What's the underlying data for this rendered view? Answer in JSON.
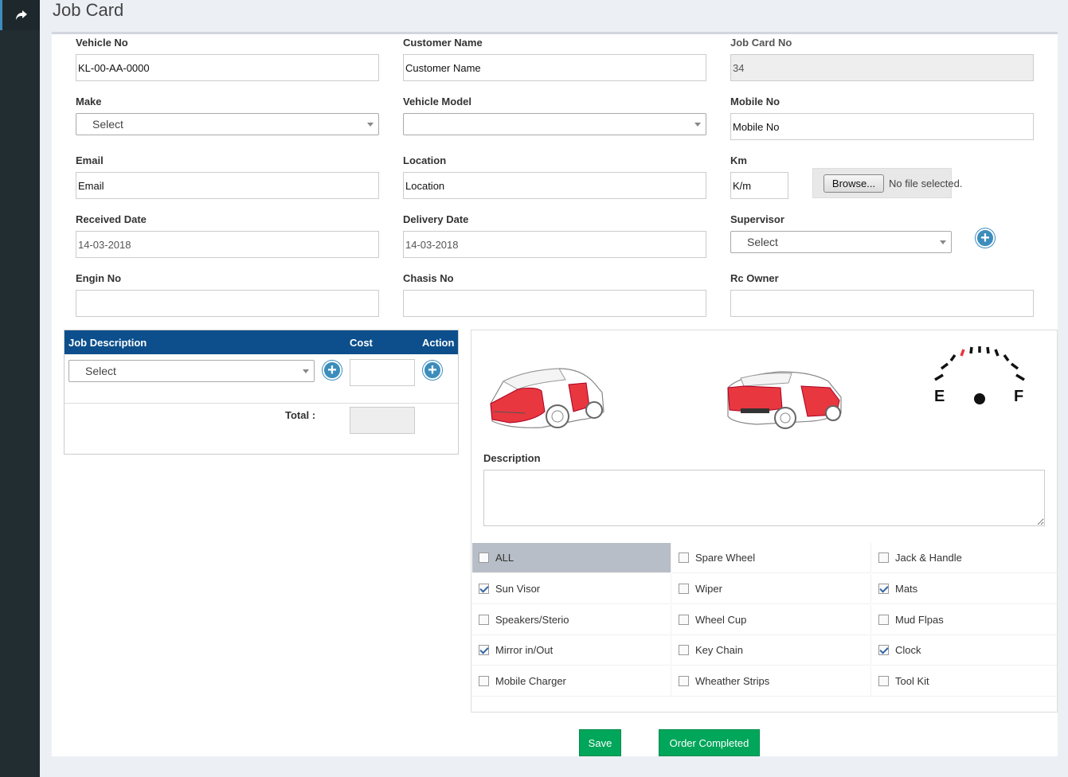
{
  "page": {
    "title": "Job Card"
  },
  "form": {
    "vehicle_no": {
      "label": "Vehicle No",
      "value": "KL-00-AA-0000"
    },
    "customer_name": {
      "label": "Customer Name",
      "value": "Customer Name"
    },
    "job_card_no": {
      "label": "Job Card No",
      "value": "34"
    },
    "make": {
      "label": "Make",
      "value": "Select"
    },
    "vehicle_model": {
      "label": "Vehicle Model",
      "value": ""
    },
    "mobile_no": {
      "label": "Mobile No",
      "value": "Mobile No"
    },
    "email": {
      "label": "Email",
      "value": "Email"
    },
    "location": {
      "label": "Location",
      "value": "Location"
    },
    "km": {
      "label": "Km",
      "value": "K/m"
    },
    "file": {
      "button": "Browse...",
      "status": "No file selected."
    },
    "received_date": {
      "label": "Received Date",
      "value": "14-03-2018"
    },
    "delivery_date": {
      "label": "Delivery Date",
      "value": "14-03-2018"
    },
    "supervisor": {
      "label": "Supervisor",
      "value": "Select"
    },
    "engin_no": {
      "label": "Engin No",
      "value": ""
    },
    "chasis_no": {
      "label": "Chasis No",
      "value": ""
    },
    "rc_owner": {
      "label": "Rc Owner",
      "value": ""
    }
  },
  "job_table": {
    "headers": {
      "description": "Job Description",
      "cost": "Cost",
      "action": "Action"
    },
    "select_value": "Select",
    "total_label": "Total :"
  },
  "inspection": {
    "fuel_empty": "E",
    "fuel_full": "F",
    "description_label": "Description",
    "checklist": [
      {
        "label": "ALL",
        "checked": false
      },
      {
        "label": "Spare Wheel",
        "checked": false
      },
      {
        "label": "Jack & Handle",
        "checked": false
      },
      {
        "label": "Sun Visor",
        "checked": true
      },
      {
        "label": "Wiper",
        "checked": false
      },
      {
        "label": "Mats",
        "checked": true
      },
      {
        "label": "Speakers/Sterio",
        "checked": false
      },
      {
        "label": "Wheel Cup",
        "checked": false
      },
      {
        "label": "Mud Flpas",
        "checked": false
      },
      {
        "label": "Mirror in/Out",
        "checked": true
      },
      {
        "label": "Key Chain",
        "checked": false
      },
      {
        "label": "Clock",
        "checked": true
      },
      {
        "label": "Mobile Charger",
        "checked": false
      },
      {
        "label": "Wheather Strips",
        "checked": false
      },
      {
        "label": "Tool Kit",
        "checked": false
      }
    ]
  },
  "actions": {
    "save": "Save",
    "order_completed": "Order Completed"
  },
  "colors": {
    "primary_blue": "#0c4f8c",
    "accent_blue": "#3c8dbc",
    "success_green": "#00a65a",
    "damage_red": "#e8373f"
  },
  "icons": {
    "sidebar_toggle": "share-arrow-icon",
    "add": "plus-circle-icon"
  }
}
